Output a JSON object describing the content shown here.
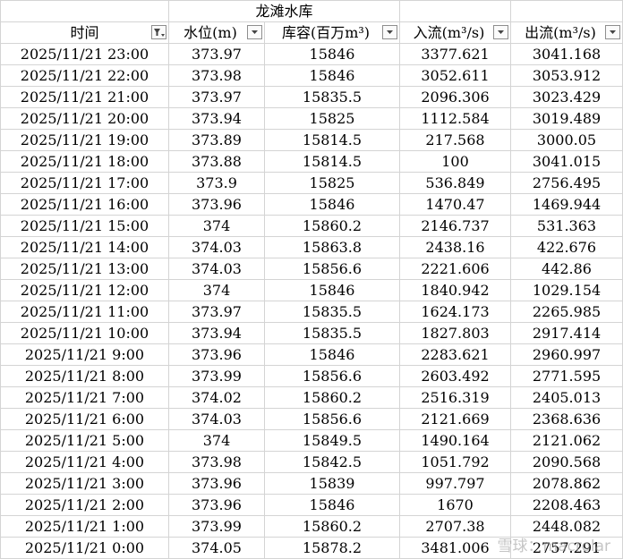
{
  "sheet": {
    "title": "龙滩水库",
    "headers": [
      {
        "label": "时间",
        "filter_icon": "filter-active-icon"
      },
      {
        "label": "水位(m)",
        "filter_icon": "dropdown-arrow-icon"
      },
      {
        "label": "库容(百万m³)",
        "filter_icon": "dropdown-arrow-icon"
      },
      {
        "label": "入流(m³/s)",
        "filter_icon": "dropdown-arrow-icon"
      },
      {
        "label": "出流(m³/s)",
        "filter_icon": "dropdown-arrow-icon"
      }
    ],
    "rows": [
      [
        "2025/11/21 23:00",
        "373.97",
        "15846",
        "3377.621",
        "3041.168"
      ],
      [
        "2025/11/21 22:00",
        "373.98",
        "15846",
        "3052.611",
        "3053.912"
      ],
      [
        "2025/11/21 21:00",
        "373.97",
        "15835.5",
        "2096.306",
        "3023.429"
      ],
      [
        "2025/11/21 20:00",
        "373.94",
        "15825",
        "1112.584",
        "3019.489"
      ],
      [
        "2025/11/21 19:00",
        "373.89",
        "15814.5",
        "217.568",
        "3000.05"
      ],
      [
        "2025/11/21 18:00",
        "373.88",
        "15814.5",
        "100",
        "3041.015"
      ],
      [
        "2025/11/21 17:00",
        "373.9",
        "15825",
        "536.849",
        "2756.495"
      ],
      [
        "2025/11/21 16:00",
        "373.96",
        "15846",
        "1470.47",
        "1469.944"
      ],
      [
        "2025/11/21 15:00",
        "374",
        "15860.2",
        "2146.737",
        "531.363"
      ],
      [
        "2025/11/21 14:00",
        "374.03",
        "15863.8",
        "2438.16",
        "422.676"
      ],
      [
        "2025/11/21 13:00",
        "374.03",
        "15856.6",
        "2221.606",
        "442.86"
      ],
      [
        "2025/11/21 12:00",
        "374",
        "15846",
        "1840.942",
        "1029.154"
      ],
      [
        "2025/11/21 11:00",
        "373.97",
        "15835.5",
        "1624.173",
        "2265.985"
      ],
      [
        "2025/11/21 10:00",
        "373.94",
        "15835.5",
        "1827.803",
        "2917.414"
      ],
      [
        "2025/11/21 9:00",
        "373.96",
        "15846",
        "2283.621",
        "2960.997"
      ],
      [
        "2025/11/21 8:00",
        "373.99",
        "15856.6",
        "2603.492",
        "2771.595"
      ],
      [
        "2025/11/21 7:00",
        "374.02",
        "15860.2",
        "2516.319",
        "2405.013"
      ],
      [
        "2025/11/21 6:00",
        "374.03",
        "15856.6",
        "2121.669",
        "2368.636"
      ],
      [
        "2025/11/21 5:00",
        "374",
        "15849.5",
        "1490.164",
        "2121.062"
      ],
      [
        "2025/11/21 4:00",
        "373.98",
        "15842.5",
        "1051.792",
        "2090.568"
      ],
      [
        "2025/11/21 3:00",
        "373.96",
        "15839",
        "997.797",
        "2078.862"
      ],
      [
        "2025/11/21 2:00",
        "373.96",
        "15846",
        "1670",
        "2208.463"
      ],
      [
        "2025/11/21 1:00",
        "373.99",
        "15860.2",
        "2707.38",
        "2448.082"
      ],
      [
        "2025/11/21 0:00",
        "374.05",
        "15878.2",
        "3481.006",
        "2757.291"
      ]
    ]
  },
  "watermark": "雪球：macrolar",
  "colors": {
    "gridline": "#d4d4d4",
    "filter_border": "#8e8e8e"
  }
}
